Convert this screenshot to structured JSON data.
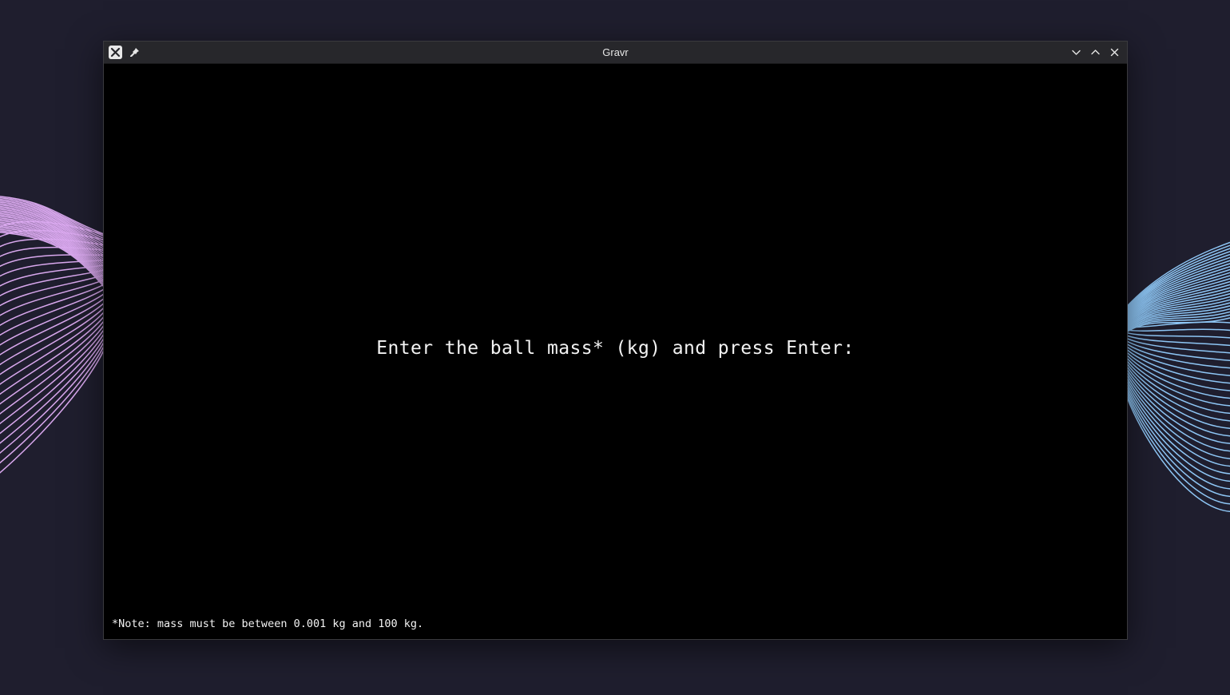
{
  "window": {
    "title": "Gravr"
  },
  "content": {
    "prompt": "Enter the ball mass* (kg) and press Enter:",
    "note": "*Note: mass must be between 0.001 kg and 100 kg."
  },
  "icons": {
    "app": "close-x-icon",
    "pin": "pin-icon",
    "minimize": "chevron-down-icon",
    "maximize": "chevron-up-icon",
    "close": "close-icon"
  },
  "colors": {
    "desktop": "#1f1e2e",
    "titlebar": "#27272b",
    "content": "#000000",
    "text": "#f2f2f2",
    "wallpaper_left": "#d9a8ee",
    "wallpaper_right": "#8ec6f5"
  }
}
